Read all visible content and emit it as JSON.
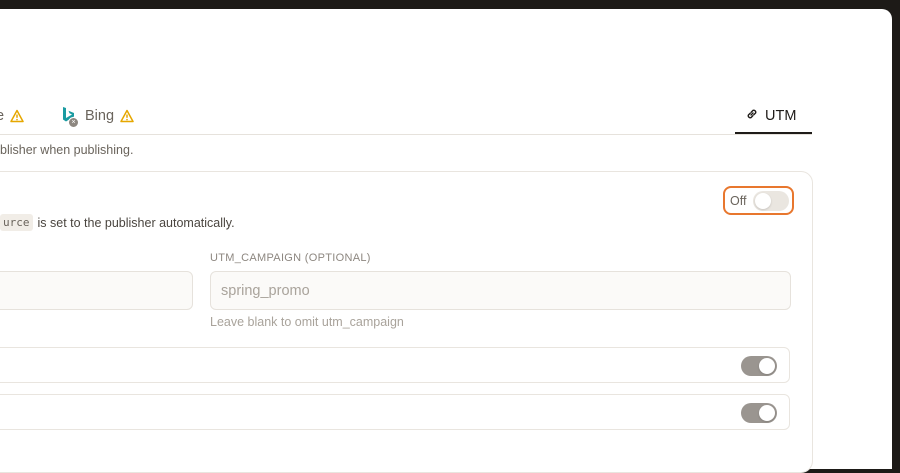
{
  "tabs": [
    {
      "label": "e",
      "warning": true
    },
    {
      "label": "Bing",
      "warning": true
    },
    {
      "label": "UTM",
      "active": true
    }
  ],
  "helper_text": "blisher when publishing.",
  "card": {
    "description_code": "urce",
    "description_text": "is set to the publisher automatically.",
    "master_toggle_label": "Off",
    "master_toggle_on": false
  },
  "fields": {
    "campaign_label": "UTM_CAMPAIGN (OPTIONAL)",
    "campaign_placeholder": "spring_promo",
    "campaign_hint": "Leave blank to omit utm_campaign",
    "left_value": ""
  },
  "rows": [
    {
      "enabled": true
    },
    {
      "enabled": true
    }
  ],
  "colors": {
    "accent": "#e8772e",
    "warning": "#e6a700",
    "bing": "#1a9ba1"
  }
}
